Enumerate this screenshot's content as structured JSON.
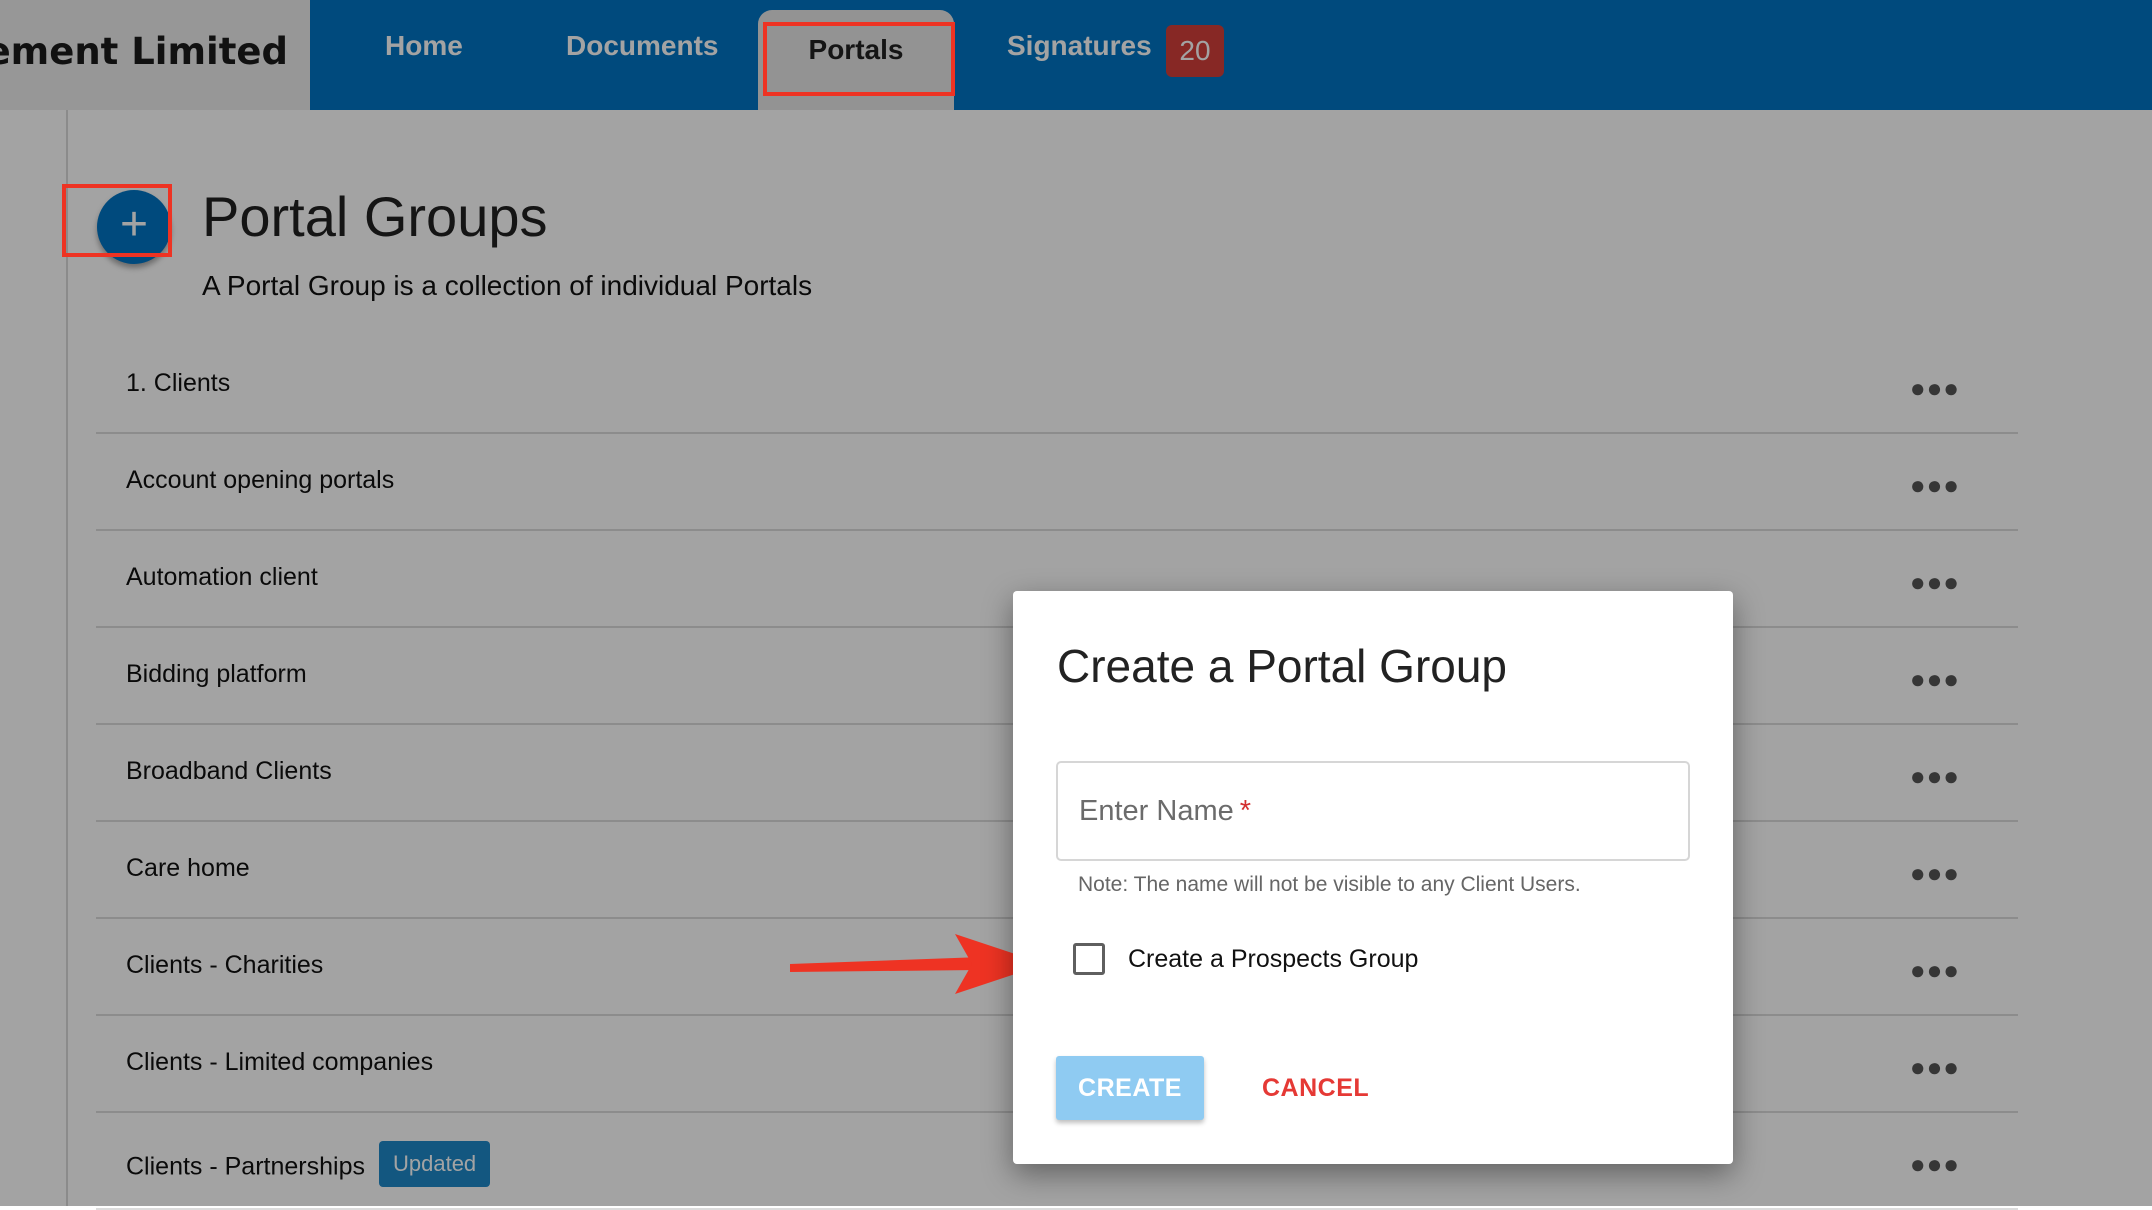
{
  "header": {
    "brand": "gement Limited",
    "nav": [
      {
        "label": "Home"
      },
      {
        "label": "Documents"
      },
      {
        "label": "Portals"
      },
      {
        "label": "Signatures"
      }
    ],
    "signatures_badge": "20"
  },
  "page": {
    "add_icon": "+",
    "title": "Portal Groups",
    "subtitle": "A Portal Group is a collection of individual Portals"
  },
  "groups": [
    {
      "name": "1. Clients"
    },
    {
      "name": "Account opening portals"
    },
    {
      "name": "Automation client"
    },
    {
      "name": "Bidding platform"
    },
    {
      "name": "Broadband Clients"
    },
    {
      "name": "Care home"
    },
    {
      "name": "Clients - Charities"
    },
    {
      "name": "Clients - Limited companies"
    },
    {
      "name": "Clients - Partnerships",
      "badge": "Updated"
    }
  ],
  "more_glyph": "●●●",
  "dialog": {
    "title": "Create a Portal Group",
    "name_placeholder": "Enter Name",
    "required_mark": "*",
    "name_value": "",
    "note": "Note: The name will not be visible to any Client Users.",
    "prospects_checkbox_label": "Create a Prospects Group",
    "prospects_checked": false,
    "create_label": "CREATE",
    "cancel_label": "CANCEL"
  },
  "colors": {
    "brand_blue": "#0075c4",
    "annotation_red": "#ee3323",
    "badge_red": "#d43f3a",
    "create_disabled": "#8fcbf2",
    "cancel_red": "#e53935"
  }
}
